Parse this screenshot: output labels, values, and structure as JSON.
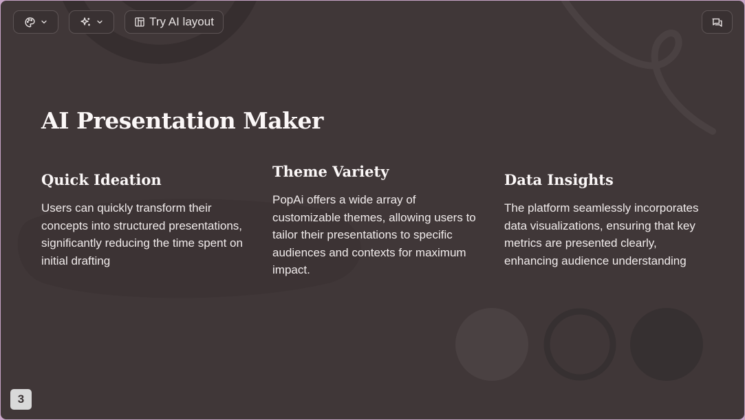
{
  "toolbar": {
    "theme_icon": "palette-icon",
    "ai_icon": "sparkles-icon",
    "layout_icon": "layout-icon",
    "try_ai_label": "Try AI layout",
    "comment_icon": "comments-icon"
  },
  "slide": {
    "title": "AI Presentation Maker",
    "columns": [
      {
        "heading": "Quick Ideation",
        "body": "Users can quickly transform their concepts into structured presentations, significantly reducing the time spent on initial drafting"
      },
      {
        "heading": "Theme Variety",
        "body": "PopAi offers a wide array of customizable themes, allowing users to tailor their presentations to specific audiences and contexts for maximum impact."
      },
      {
        "heading": "Data Insights",
        "body": "The platform seamlessly incorporates data visualizations, ensuring that key metrics are presented clearly, enhancing audience understanding"
      }
    ],
    "page_number": "3"
  },
  "colors": {
    "slide_background": "#403738",
    "frame": "#c9a6c9",
    "text": "#fbf7f7"
  }
}
